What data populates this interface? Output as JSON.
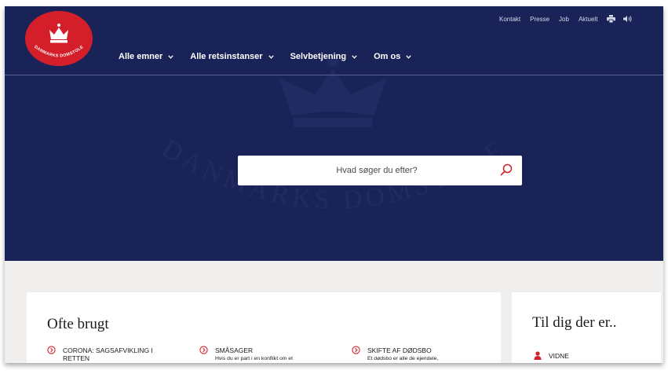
{
  "brand": {
    "name": "DANMARKS DOMSTOLE",
    "logo_color": "#d41f2a",
    "logo_icon": "crown-icon",
    "watermark_text": "DANMARKS DOMSTOLE"
  },
  "colors": {
    "hero_bg": "#1a2357",
    "accent": "#d41f2a",
    "page_bg": "#f0efed"
  },
  "utility_nav": {
    "items": [
      {
        "label": "Kontakt"
      },
      {
        "label": "Presse"
      },
      {
        "label": "Job"
      },
      {
        "label": "Aktuelt"
      }
    ],
    "icons": [
      "print-icon",
      "speaker-icon"
    ]
  },
  "main_nav": {
    "items": [
      {
        "label": "Alle emner"
      },
      {
        "label": "Alle retsinstanser"
      },
      {
        "label": "Selvbetjening"
      },
      {
        "label": "Om os"
      }
    ]
  },
  "search": {
    "placeholder": "Hvad søger du efter?",
    "value": ""
  },
  "frequently_used": {
    "title": "Ofte brugt",
    "links": [
      {
        "title": "CORONA: SAGSAFVIKLING I RETTEN",
        "desc": ""
      },
      {
        "title": "SMÅSAGER",
        "desc": "Hvis du er part i en konflikt om et"
      },
      {
        "title": "SKIFTE AF DØDSBO",
        "desc": "Et dødsbo er alle de ejendele,"
      }
    ]
  },
  "for_you": {
    "title": "Til dig der er..",
    "links": [
      {
        "label": "VIDNE"
      }
    ]
  }
}
